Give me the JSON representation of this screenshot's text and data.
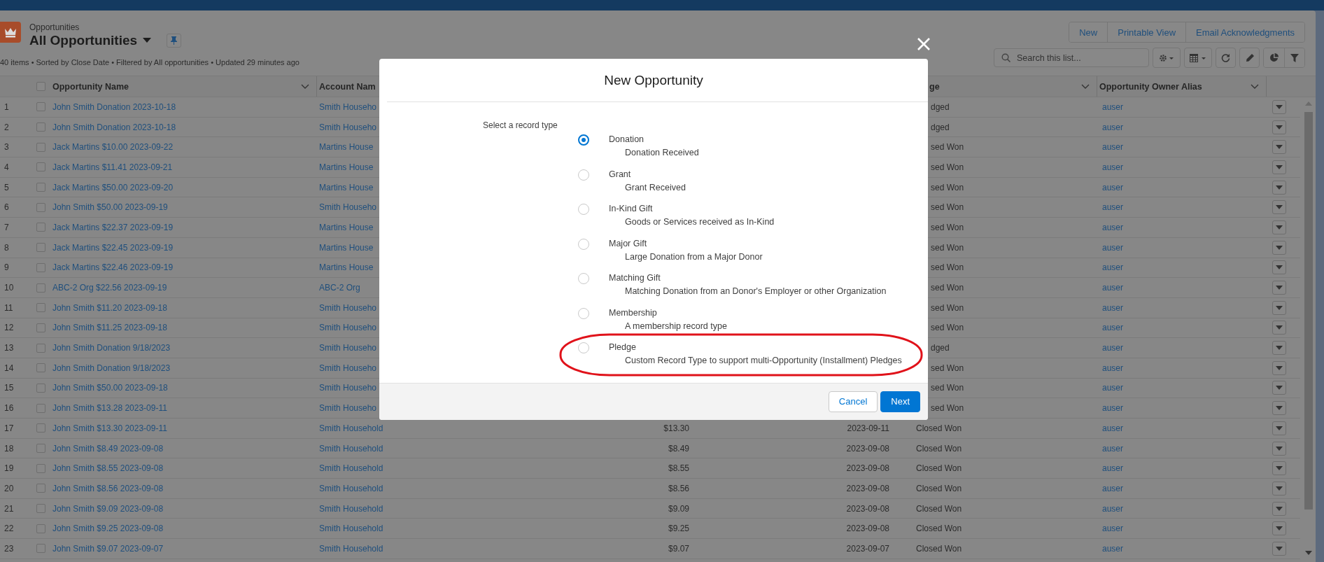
{
  "list_header": {
    "object_label": "Opportunities",
    "view_title": "All Opportunities",
    "status": "40 items • Sorted by Close Date • Filtered by All opportunities • Updated 29 minutes ago",
    "actions": [
      "New",
      "Printable View",
      "Email Acknowledgments"
    ],
    "search": {
      "placeholder": "Search this list..."
    }
  },
  "table": {
    "select_all": {
      "checked": false
    },
    "columns": [
      {
        "label": "Opportunity Name"
      },
      {
        "label": "Account Nam"
      },
      {
        "label": "ge"
      },
      {
        "label": "Opportunity Owner Alias"
      }
    ],
    "rows": [
      {
        "number": "1",
        "checked": false,
        "name": "John Smith Donation 2023-10-18",
        "account": "Smith Househo",
        "stage": "dged",
        "owner": "auser"
      },
      {
        "number": "2",
        "checked": false,
        "name": "John Smith Donation 2023-10-18",
        "account": "Smith Househo",
        "stage": "dged",
        "owner": "auser"
      },
      {
        "number": "3",
        "checked": false,
        "name": "Jack Martins $10.00 2023-09-22",
        "account": "Martins House",
        "stage": "sed Won",
        "owner": "auser"
      },
      {
        "number": "4",
        "checked": false,
        "name": "Jack Martins $11.41 2023-09-21",
        "account": "Martins House",
        "stage": "sed Won",
        "owner": "auser"
      },
      {
        "number": "5",
        "checked": false,
        "name": "Jack Martins $50.00 2023-09-20",
        "account": "Martins House",
        "stage": "sed Won",
        "owner": "auser"
      },
      {
        "number": "6",
        "checked": false,
        "name": "John Smith $50.00 2023-09-19",
        "account": "Smith Househo",
        "stage": "sed Won",
        "owner": "auser"
      },
      {
        "number": "7",
        "checked": false,
        "name": "Jack Martins $22.37 2023-09-19",
        "account": "Martins House",
        "stage": "sed Won",
        "owner": "auser"
      },
      {
        "number": "8",
        "checked": false,
        "name": "Jack Martins $22.45 2023-09-19",
        "account": "Martins House",
        "stage": "sed Won",
        "owner": "auser"
      },
      {
        "number": "9",
        "checked": false,
        "name": "Jack Martins $22.46 2023-09-19",
        "account": "Martins House",
        "stage": "sed Won",
        "owner": "auser"
      },
      {
        "number": "10",
        "checked": false,
        "name": "ABC-2 Org $22.56 2023-09-19",
        "account": "ABC-2 Org",
        "stage": "sed Won",
        "owner": "auser"
      },
      {
        "number": "11",
        "checked": false,
        "name": "John Smith $11.20 2023-09-18",
        "account": "Smith Househo",
        "stage": "sed Won",
        "owner": "auser"
      },
      {
        "number": "12",
        "checked": false,
        "name": "John Smith $11.25 2023-09-18",
        "account": "Smith Househo",
        "stage": "sed Won",
        "owner": "auser"
      },
      {
        "number": "13",
        "checked": false,
        "name": "John Smith Donation 9/18/2023",
        "account": "Smith Househo",
        "stage": "dged",
        "owner": "auser"
      },
      {
        "number": "14",
        "checked": false,
        "name": "John Smith Donation 9/18/2023",
        "account": "Smith Househo",
        "stage": "sed Won",
        "owner": "auser"
      },
      {
        "number": "15",
        "checked": false,
        "name": "John Smith $50.00 2023-09-18",
        "account": "Smith Househo",
        "stage": "sed Won",
        "owner": "auser"
      },
      {
        "number": "16",
        "checked": false,
        "name": "John Smith $13.28 2023-09-11",
        "account": "Smith Househo",
        "stage": "sed Won",
        "owner": "auser"
      },
      {
        "number": "17",
        "checked": false,
        "name": "John Smith $13.30 2023-09-11",
        "account": "Smith Household",
        "amount": "$13.30",
        "close_date": "2023-09-11",
        "stage": "Closed Won",
        "owner": "auser"
      },
      {
        "number": "18",
        "checked": false,
        "name": "John Smith $8.49 2023-09-08",
        "account": "Smith Household",
        "amount": "$8.49",
        "close_date": "2023-09-08",
        "stage": "Closed Won",
        "owner": "auser"
      },
      {
        "number": "19",
        "checked": false,
        "name": "John Smith $8.55 2023-09-08",
        "account": "Smith Household",
        "amount": "$8.55",
        "close_date": "2023-09-08",
        "stage": "Closed Won",
        "owner": "auser"
      },
      {
        "number": "20",
        "checked": false,
        "name": "John Smith $8.56 2023-09-08",
        "account": "Smith Household",
        "amount": "$8.56",
        "close_date": "2023-09-08",
        "stage": "Closed Won",
        "owner": "auser"
      },
      {
        "number": "21",
        "checked": false,
        "name": "John Smith $9.09 2023-09-08",
        "account": "Smith Household",
        "amount": "$9.09",
        "close_date": "2023-09-08",
        "stage": "Closed Won",
        "owner": "auser"
      },
      {
        "number": "22",
        "checked": false,
        "name": "John Smith $9.25 2023-09-08",
        "account": "Smith Household",
        "amount": "$9.25",
        "close_date": "2023-09-08",
        "stage": "Closed Won",
        "owner": "auser"
      },
      {
        "number": "23",
        "checked": false,
        "name": "John Smith $9.07 2023-09-07",
        "account": "Smith Household",
        "amount": "$9.07",
        "close_date": "2023-09-07",
        "stage": "Closed Won",
        "owner": "auser"
      }
    ]
  },
  "modal": {
    "title": "New Opportunity",
    "prompt": "Select a record type",
    "options": [
      {
        "label": "Donation",
        "description": "Donation Received",
        "selected": true,
        "highlighted": false
      },
      {
        "label": "Grant",
        "description": "Grant Received",
        "selected": false,
        "highlighted": false
      },
      {
        "label": "In-Kind Gift",
        "description": "Goods or Services received as In-Kind",
        "selected": false,
        "highlighted": false
      },
      {
        "label": "Major Gift",
        "description": "Large Donation from a Major Donor",
        "selected": false,
        "highlighted": false
      },
      {
        "label": "Matching Gift",
        "description": "Matching Donation from an Donor's Employer or other Organization",
        "selected": false,
        "highlighted": false
      },
      {
        "label": "Membership",
        "description": "A membership record type",
        "selected": false,
        "highlighted": false
      },
      {
        "label": "Pledge",
        "description": "Custom Record Type to support multi-Opportunity (Installment) Pledges",
        "selected": false,
        "highlighted": true
      }
    ],
    "buttons": [
      {
        "label": "Cancel",
        "kind": "secondary"
      },
      {
        "label": "Next",
        "kind": "primary"
      }
    ]
  }
}
